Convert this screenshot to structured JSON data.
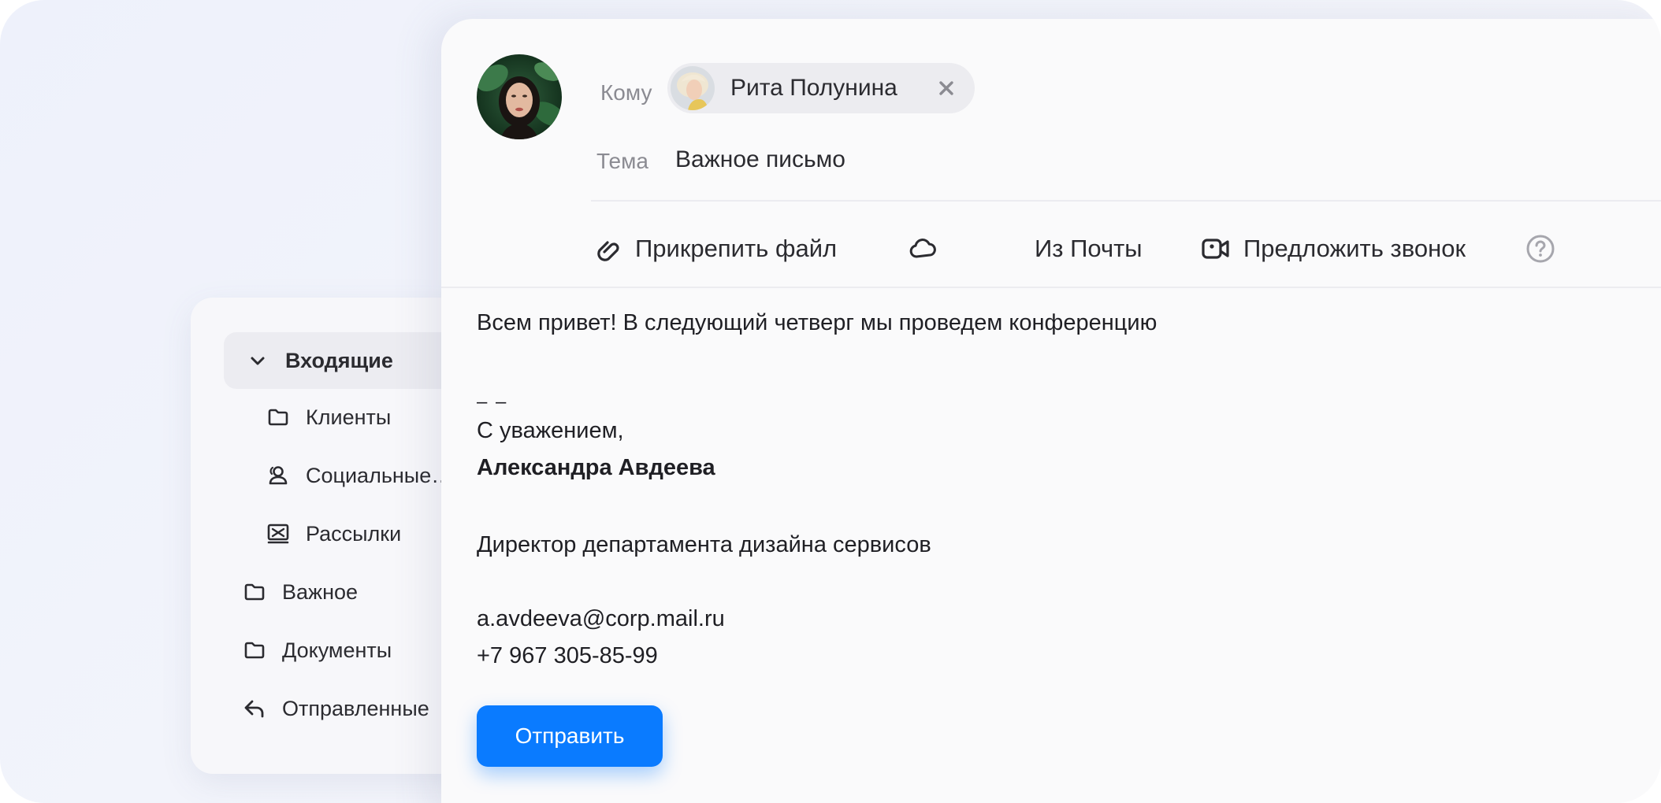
{
  "folders": {
    "inbox": "Входящие",
    "clients": "Клиенты",
    "social": "Социальные…",
    "newsletters": "Рассылки",
    "important": "Важное",
    "documents": "Документы",
    "sent": "Отправленные"
  },
  "compose": {
    "to_label": "Кому",
    "recipient": "Рита Полунина",
    "subject_label": "Тема",
    "subject": "Важное письмо",
    "toolbar": {
      "attach": "Прикрепить файл",
      "from_mail": "Из Почты",
      "suggest_call": "Предложить звонок"
    },
    "body": {
      "greeting": "Всем привет! В следующий четверг мы проведем конференцию",
      "separator": "– –",
      "regards": "С уважением,",
      "signature_name": "Александра Авдеева",
      "position": "Директор департамента дизайна сервисов",
      "email": "a.avdeeva@corp.mail.ru",
      "phone": "+7 967 305-85-99"
    },
    "send_label": "Отправить"
  },
  "colors": {
    "accent": "#0a7bff",
    "text": "#1f1f24",
    "muted": "#8b8b92"
  }
}
